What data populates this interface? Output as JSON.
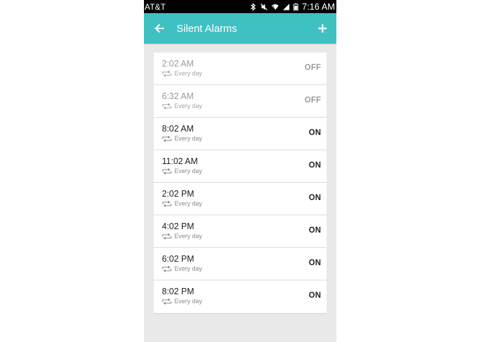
{
  "status_bar": {
    "carrier": "AT&T",
    "time": "7:16 AM",
    "icons": [
      "bluetooth-icon",
      "mute-icon",
      "wifi-icon",
      "signal-icon",
      "battery-icon"
    ]
  },
  "app_bar": {
    "title": "Silent Alarms",
    "back_icon": "arrow-left-icon",
    "add_icon": "plus-icon",
    "color": "#3fc1c2"
  },
  "alarms": [
    {
      "time": "2:02 AM",
      "repeat": "Every day",
      "state": "OFF"
    },
    {
      "time": "6:32 AM",
      "repeat": "Every day",
      "state": "OFF"
    },
    {
      "time": "8:02 AM",
      "repeat": "Every day",
      "state": "ON"
    },
    {
      "time": "11:02 AM",
      "repeat": "Every day",
      "state": "ON"
    },
    {
      "time": "2:02 PM",
      "repeat": "Every day",
      "state": "ON"
    },
    {
      "time": "4:02 PM",
      "repeat": "Every day",
      "state": "ON"
    },
    {
      "time": "6:02 PM",
      "repeat": "Every day",
      "state": "ON"
    },
    {
      "time": "8:02 PM",
      "repeat": "Every day",
      "state": "ON"
    }
  ]
}
